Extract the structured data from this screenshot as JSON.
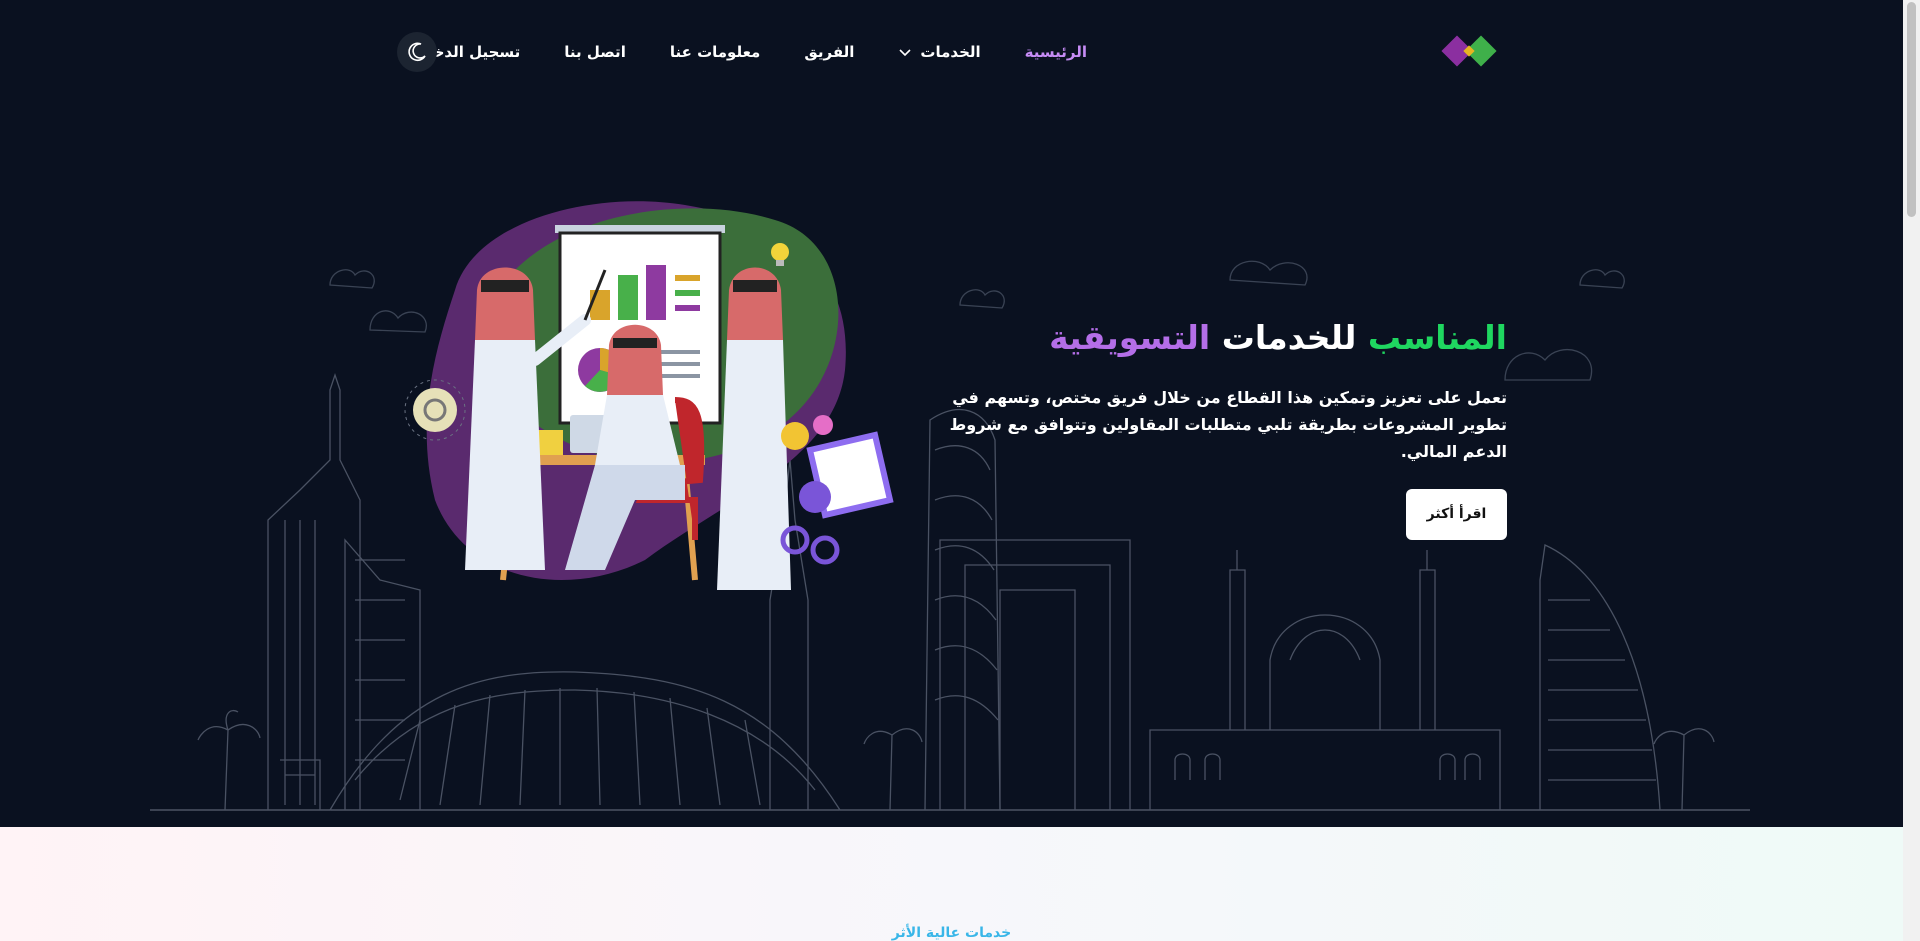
{
  "header": {
    "logo_alt": "logo",
    "nav": [
      {
        "label": "الرئيسية",
        "active": true
      },
      {
        "label": "الخدمات",
        "has_dropdown": true
      },
      {
        "label": "الفريق"
      },
      {
        "label": "معلومات عنا"
      },
      {
        "label": "اتصل بنا"
      },
      {
        "label": "تسجيل الدخول"
      }
    ],
    "theme_toggle_icon": "moon-icon"
  },
  "hero": {
    "title_part1": "المناسب",
    "title_part2": "للخدمات",
    "title_part3": "التسويقية",
    "description": "تعمل على تعزيز وتمكين هذا القطاع من خلال فريق مختص، وتسهم في تطوير المشروعات بطريقة تلبي متطلبات المقاولين وتتوافق مع شروط الدعم المالي.",
    "button_label": "اقرأ أكثر"
  },
  "next_section": {
    "title": "خدمات عالية الأثر"
  },
  "colors": {
    "background": "#0a1120",
    "accent_green": "#1fd760",
    "accent_purple": "#b46ee8",
    "nav_active": "#c68cf5"
  }
}
